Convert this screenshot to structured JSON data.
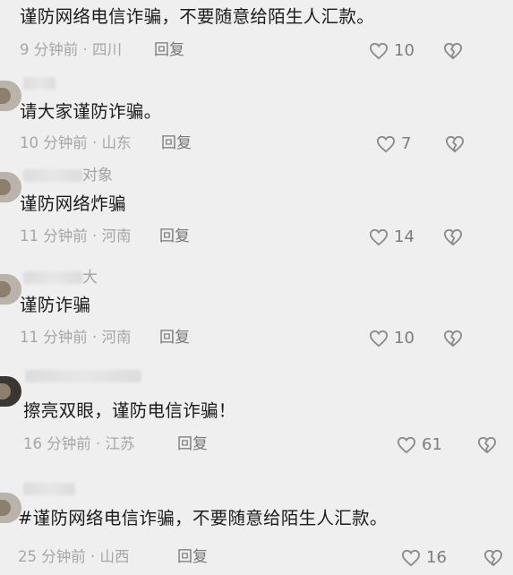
{
  "comments": [
    {
      "username": "",
      "text": "谨防网络电信诈骗，不要随意给陌生人汇款。",
      "time": "9 分钟前 · 四川",
      "reply": "回复",
      "likes": "10"
    },
    {
      "username": "",
      "text": "请大家谨防诈骗。",
      "time": "10 分钟前 · 山东",
      "reply": "回复",
      "likes": "7"
    },
    {
      "username": "对象",
      "text": "谨防网络炸骗",
      "time": "11 分钟前 · 河南",
      "reply": "回复",
      "likes": "14"
    },
    {
      "username": "大",
      "text": "谨防诈骗",
      "time": "11 分钟前 · 河南",
      "reply": "回复",
      "likes": "10"
    },
    {
      "username": "",
      "text": "擦亮双眼，谨防电信诈骗！",
      "time": "16 分钟前 · 江苏",
      "reply": "回复",
      "likes": "61"
    },
    {
      "username": "",
      "text": "#谨防网络电信诈骗，不要随意给陌生人汇款。",
      "time": "25 分钟前 · 山西",
      "reply": "回复",
      "likes": "16"
    }
  ],
  "icons": {
    "like": "heart-outline-icon",
    "dislike": "broken-heart-icon"
  },
  "colors": {
    "background": "#efefef",
    "text": "#1b1b1b",
    "meta": "#a6a6a6"
  }
}
